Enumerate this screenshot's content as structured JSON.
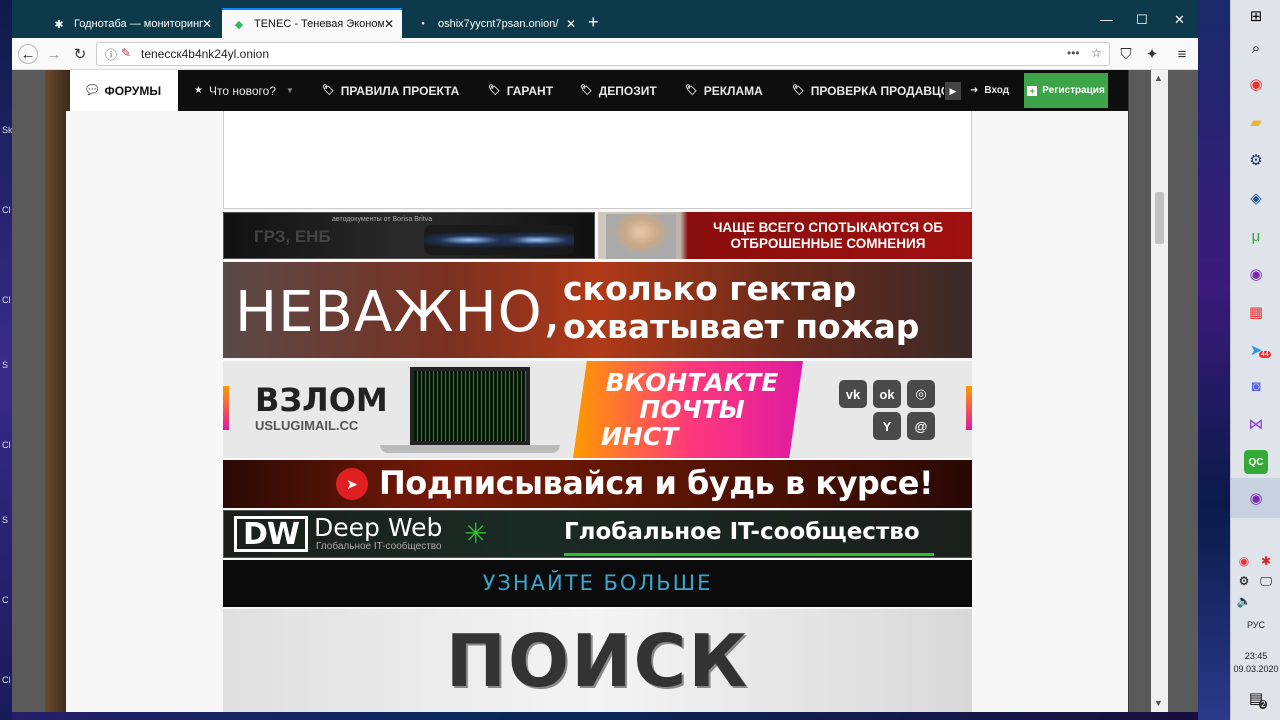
{
  "tabs": [
    {
      "title": "Годнотаба — мониторинг год",
      "icon": "spider-icon"
    },
    {
      "title": "TENEC - Теневая Экономика",
      "icon": "logo-icon"
    },
    {
      "title": "oshix7yycnt7psan.onion/",
      "icon": "dot-icon"
    }
  ],
  "url": "teneccк4b4nk24yl.onion",
  "forum_nav": {
    "forums": "ФОРУМЫ",
    "whats_new": "Что нового?",
    "rules": "ПРАВИЛА ПРОЕКТА",
    "garant": "ГАРАНТ",
    "deposit": "ДЕПОЗИТ",
    "ads": "РЕКЛАМА",
    "check": "ПРОВЕРКА ПРОДАВЦО",
    "login": "Вход",
    "register": "Регистрация"
  },
  "banners": {
    "small1_caption": "автодокументы от Borisa Britva",
    "small1_text": "ГРЗ, ЕНБ",
    "small2_text": "ЧАЩЕ ВСЕГО СПОТЫКАЮТСЯ ОБ ОТБРОШЕННЫЕ СОМНЕНИЯ",
    "fire_big": "НЕВАЖНО,",
    "fire_line1": "сколько гектар",
    "fire_line2": "охватывает пожар",
    "vzlom_title": "ВЗЛОМ",
    "vzlom_site": "USLUGIMAIL.CC",
    "vzlom_line1": "ВКОНТАКТЕ",
    "vzlom_line2": "ПОЧТЫ",
    "vzlom_line3": "ИНСТ",
    "telegram_text": "Подписывайся и будь в курсе!",
    "dw_logo": "DW",
    "dw_name": "Deep Web",
    "dw_sub": "Глобальное IT-сообщество",
    "dw_right": "Глобальное IT-сообщество",
    "learn_more": "УЗНАЙТЕ БОЛЬШЕ",
    "search": "ПОИСК"
  },
  "taskbar": {
    "lang": "РУС",
    "time": "23:45",
    "date": "09.03.2020",
    "notif_count": "2",
    "telegram_badge": "44"
  }
}
